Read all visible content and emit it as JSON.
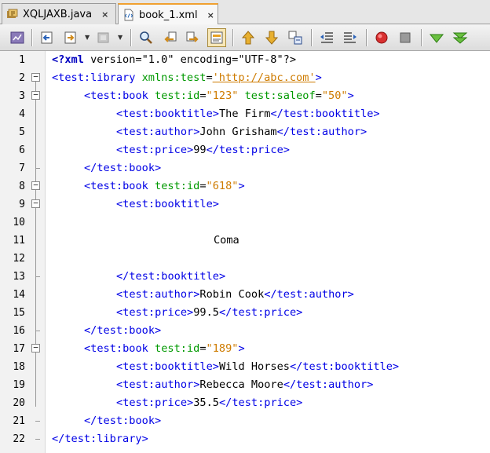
{
  "tabs": [
    {
      "label": "XQLJAXB.java",
      "icon": "java-file-icon",
      "active": false
    },
    {
      "label": "book_1.xml",
      "icon": "xml-file-icon",
      "active": true
    }
  ],
  "tab_close_glyph": "×",
  "toolbar": {
    "buttons": [
      "history-icon",
      "back-icon",
      "forward-menu-icon",
      "disabled-icon",
      "find-icon",
      "find-previous-icon",
      "find-next-icon",
      "toggle-highlight-icon",
      "previous-bookmark-icon",
      "next-bookmark-icon",
      "toggle-bookmark-icon",
      "shift-left-icon",
      "shift-right-icon",
      "start-macro-icon",
      "stop-macro-icon",
      "check-xml-icon",
      "validate-xml-icon"
    ]
  },
  "editor": {
    "line_numbers": [
      "1",
      "2",
      "3",
      "4",
      "5",
      "6",
      "7",
      "8",
      "9",
      "10",
      "11",
      "12",
      "13",
      "14",
      "15",
      "16",
      "17",
      "18",
      "19",
      "20",
      "21",
      "22"
    ],
    "lines": {
      "l1": {
        "a": "<?xml",
        "b": " version=\"1.0\" encoding=\"UTF-8\"?>"
      },
      "l2": {
        "a": "<test:library",
        "b": " xmlns:test",
        "c": "=",
        "d": "'http://abc.com'",
        "e": ">"
      },
      "l3": {
        "a": "<test:book",
        "b": " test:id",
        "c": "=",
        "d": "\"123\"",
        "e": " test:saleof",
        "f": "=",
        "g": "\"50\"",
        "h": ">"
      },
      "l4": {
        "a": "<test:booktitle>",
        "b": "The Firm",
        "c": "</test:booktitle>"
      },
      "l5": {
        "a": "<test:author>",
        "b": "John Grisham",
        "c": "</test:author>"
      },
      "l6": {
        "a": "<test:price>",
        "b": "99",
        "c": "</test:price>"
      },
      "l7": {
        "a": "</test:book>"
      },
      "l8": {
        "a": "<test:book",
        "b": " test:id",
        "c": "=",
        "d": "\"618\"",
        "e": ">"
      },
      "l9": {
        "a": "<test:booktitle>"
      },
      "l11": {
        "a": "Coma"
      },
      "l13": {
        "a": "</test:booktitle>"
      },
      "l14": {
        "a": "<test:author>",
        "b": "Robin Cook",
        "c": "</test:author>"
      },
      "l15": {
        "a": "<test:price>",
        "b": "99.5",
        "c": "</test:price>"
      },
      "l16": {
        "a": "</test:book>"
      },
      "l17": {
        "a": "<test:book",
        "b": " test:id",
        "c": "=",
        "d": "\"189\"",
        "e": ">"
      },
      "l18": {
        "a": "<test:booktitle>",
        "b": "Wild Horses",
        "c": "</test:booktitle>"
      },
      "l19": {
        "a": "<test:author>",
        "b": "Rebecca Moore",
        "c": "</test:author>"
      },
      "l20": {
        "a": "<test:price>",
        "b": "35.5",
        "c": "</test:price>"
      },
      "l21": {
        "a": "</test:book>"
      },
      "l22": {
        "a": "</test:library>"
      }
    }
  },
  "colors": {
    "tag": "#0000e6",
    "attribute": "#009900",
    "value": "#ce7b00",
    "active_tab_accent": "#f0a030"
  }
}
